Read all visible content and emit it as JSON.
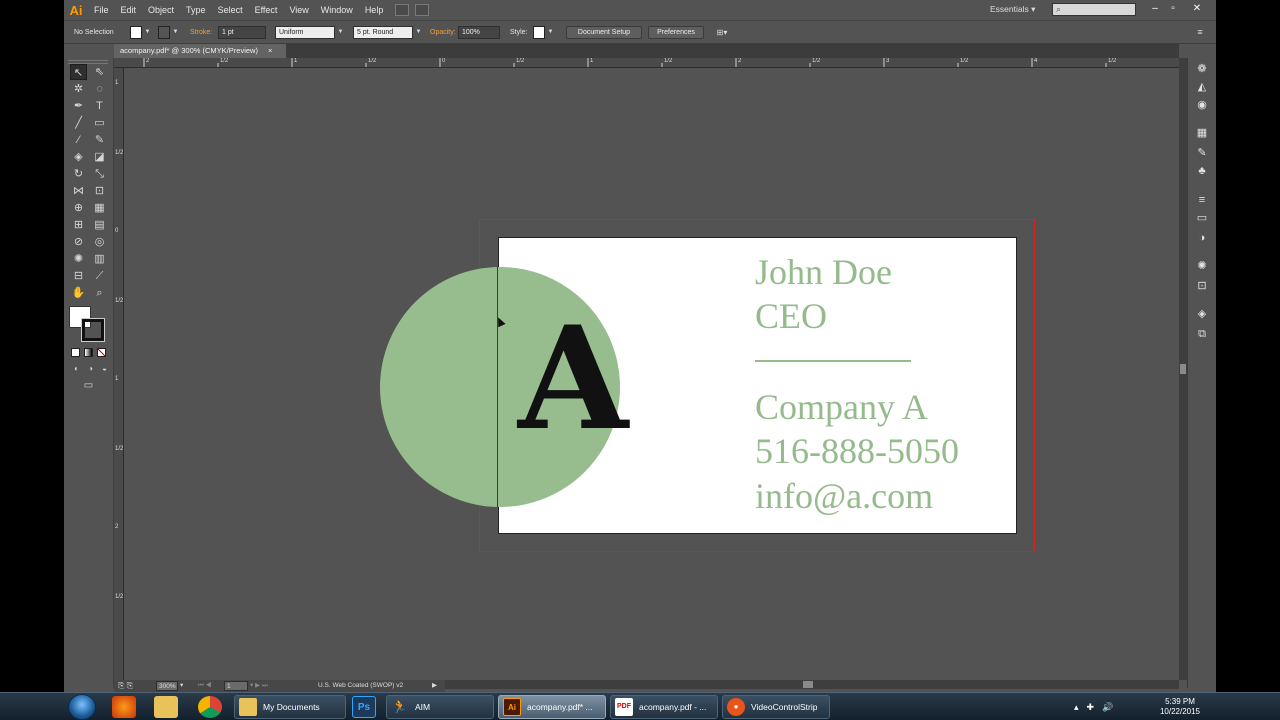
{
  "app": {
    "logo": "Ai",
    "menus": [
      "File",
      "Edit",
      "Object",
      "Type",
      "Select",
      "Effect",
      "View",
      "Window",
      "Help"
    ],
    "workspace": "Essentials",
    "window_buttons": [
      "–",
      "▫",
      "✕"
    ]
  },
  "controlbar": {
    "selection": "No Selection",
    "stroke_label": "Stroke:",
    "stroke_weight": "1 pt",
    "profile": "Uniform",
    "brush": "5 pt. Round",
    "opacity_label": "Opacity:",
    "opacity": "100%",
    "style_label": "Style:",
    "doc_setup": "Document Setup",
    "preferences": "Preferences"
  },
  "document": {
    "tab_title": "acompany.pdf* @ 300% (CMYK/Preview)",
    "tab_close": "×"
  },
  "rulers": {
    "top_labels": [
      "2",
      "1/2",
      "1",
      "1/2",
      "0",
      "1/2",
      "1",
      "1/2",
      "2",
      "1/2",
      "3",
      "1/2",
      "4",
      "1/2"
    ],
    "left_labels": [
      "1",
      "1/2",
      "0",
      "1/2",
      "1",
      "1/2",
      "2",
      "1/2"
    ]
  },
  "card": {
    "letter": "A",
    "name": "John Doe",
    "title": "CEO",
    "company": "Company A",
    "phone": "516-888-5050",
    "email": "info@a.com",
    "accent_color": "#95ba8c",
    "bleed_color": "#d62424"
  },
  "statusbar": {
    "zoom": "300%",
    "artboard": "1",
    "profile": "U.S. Web Coated (SWOP) v2"
  },
  "taskbar": {
    "tasks": [
      {
        "label": "My Documents"
      },
      {
        "label": "AIM"
      },
      {
        "label": "acompany.pdf* ..."
      },
      {
        "label": "acompany.pdf - ..."
      },
      {
        "label": "VideoControlStrip"
      }
    ],
    "clock_time": "5:39 PM",
    "clock_date": "10/22/2015"
  }
}
